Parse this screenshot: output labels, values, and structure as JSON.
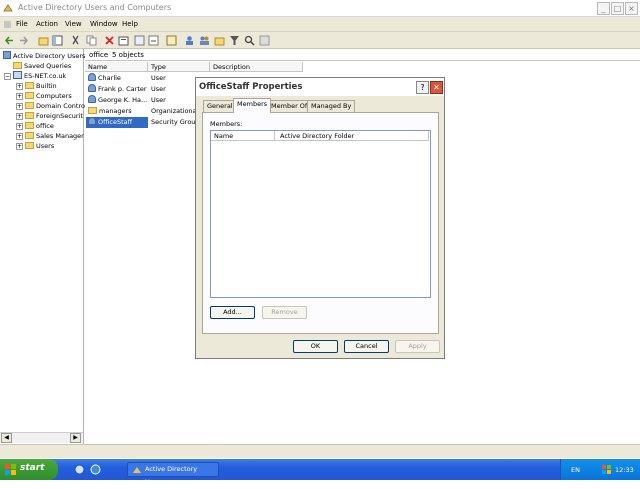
{
  "window": {
    "title": "Active Directory Users and Computers"
  },
  "menu": {
    "items": [
      "File",
      "Action",
      "View",
      "Window",
      "Help"
    ]
  },
  "toolbar": {
    "icons": [
      "back-icon",
      "forward-icon",
      "up-icon",
      "show-console-tree-icon",
      "cut-icon",
      "copy-icon",
      "delete-icon",
      "properties-icon",
      "refresh-icon",
      "export-icon",
      "help-icon",
      "new-user-icon",
      "new-group-icon",
      "new-ou-icon",
      "filter-icon",
      "find-icon",
      "add-to-group-icon"
    ]
  },
  "tree": {
    "root": "Active Directory Users",
    "items": [
      {
        "label": "Saved Queries"
      },
      {
        "label": "ES-NET.co.uk"
      },
      {
        "label": "Builtin"
      },
      {
        "label": "Computers"
      },
      {
        "label": "Domain Contro"
      },
      {
        "label": "ForeignSecurit"
      },
      {
        "label": "office"
      },
      {
        "label": "Sales Manager"
      },
      {
        "label": "Users"
      }
    ]
  },
  "list": {
    "header_title": "office",
    "header_count": "5 objects",
    "columns": [
      "Name",
      "Type",
      "Description"
    ],
    "rows": [
      {
        "name": "Charlie",
        "type": "User"
      },
      {
        "name": "Frank p. Carter",
        "type": "User"
      },
      {
        "name": "George K. Ha...",
        "type": "User"
      },
      {
        "name": "managers",
        "type": "Organizational"
      },
      {
        "name": "OfficeStaff",
        "type": "Security Group"
      }
    ]
  },
  "dialog": {
    "title": "OfficeStaff Properties",
    "help_label": "?",
    "close_label": "✕",
    "tabs": [
      "General",
      "Members",
      "Member Of",
      "Managed By"
    ],
    "members_label": "Members:",
    "columns": [
      "Name",
      "Active Directory Folder"
    ],
    "buttons": {
      "add": "Add...",
      "remove": "Remove",
      "ok": "OK",
      "cancel": "Cancel",
      "apply": "Apply"
    }
  },
  "taskbar": {
    "start_label": "start",
    "task_label": "Active Directory User...",
    "language": "EN",
    "clock": "12:33"
  },
  "colors": {
    "accent": "#245edb",
    "start_green": "#2f8e2d",
    "dialog_bg": "#ece9d8",
    "close_red": "#d9573a"
  }
}
